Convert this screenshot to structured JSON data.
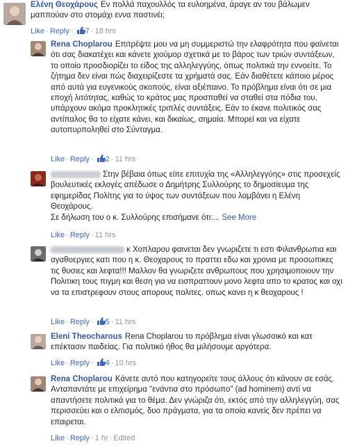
{
  "comments": [
    {
      "author": "Ελένη Θεοχάρους",
      "text": "Εν πολλά παχουλλός τα ευλοημένα, άραγε αν του βάλωμεν μαππούαν στο στομάχι εννα παστινέι;",
      "like": "Like",
      "reply": "Reply",
      "likes": "7",
      "time": "18 hrs"
    },
    {
      "author": "Rena Choplarou",
      "text": "Επιτρέψτε μου να μη συμμεριστώ την ελαφρότητα που φαίνεται ότι σας διακατέχει και κάνετε χιούμορ σχετικά με το βάρος των τριών συντάξεων, το οποίο προσδιορίζει το είδος της αλληλεγγύης, όπως πολιτικά την εννοείτε. Το ζήτημα δεν είναι πώς διαχειρίζεστε τα χρήματά σας. Εάν διαθέτετε κάποιο μέρος από αυτά για ευγενικούς σκοπούς, είναι αξιέπαινο. Το πρόβλημα είναι ότι σε μια εποχή λιτότητας, καθώς το κράτος μας προσπαθεί να σταθεί στα πόδια του, υπάρχουν ακόμα προκλητικές τριπλές συντάξεις. Εάν το έκανε πολιτικός σας αντίπαλος θα το είχατε κάνει, και δικαίως, σημαία. Μπορεί και να είχατε αυτοπυρποληθεί στο Σύνταγμα.",
      "like": "Like",
      "reply": "Reply",
      "likes": "2",
      "time": "11 hrs"
    },
    {
      "author": "",
      "text": "Στην βέβαια όπως είπε επιτυχία της «Αλληλεγγύης» στις προσεχείς βουλευτικές εκλογές απέδωσε ο Δημήτρης Συλλούρης το δημοσίευμα της εφημερίδας Πολίτης για το ύψος των συντάξεων που λαμβάνει η Ελένη Θεοχάρους.",
      "text2": "Σε δήλωση του ο κ. Συλλούρης επισήμανε ότι:...",
      "see_more": "See More",
      "like": "Like",
      "reply": "Reply",
      "time": "11 hrs"
    },
    {
      "author": "",
      "text": "κ Χοπλαρου φαινεται δεν γνωριζετε τι εστι Φιλανθρωπια και αγαθοεργιες κατι που η κ. Θεοχαρους το πραττει εδω και χρονια με προσωπικες τις θυσιες και λεφτα!!! Μαλλον θα γνωριζετε ανθρωπους που χρησιμοποιουν την Πολιτικη τους πιγμη και θεση για να εισπραττουν μονο λεφτα απο το κρατος και οχι να τα επιστρεφουν στους απορους πολιτες. οπως κανει η κ θεοχαρους !",
      "like": "Like",
      "reply": "Reply",
      "likes": "5",
      "time": "11 hrs"
    },
    {
      "author": "Eleni Theocharous",
      "text": "Rena Choplarou το πρόβλημα είναι γλωσσικό και κατ επέκτασιν παιδείας. Για πολιτικό ήθος θα μιλήσουμε αργότερα.",
      "like": "Like",
      "reply": "Reply",
      "likes": "4",
      "time": "10 hrs"
    },
    {
      "author": "Rena Choplarou",
      "text": "Κάνετε αυτό που κατηγορείτε τους άλλους ότι κάνουν σε εσάς. Ανταπαντάτε με επιχείρημα \"ενάντια στο πρόσωπο\" (ad hominem) αντί να απαντήσετε πολιτικά για το θέμα. Δεν γνώριζα ότι, εκτός από την αλληλεγγύη, σας περισσεύει και ο ελιτισμός, δυο πράγματα, για τα οποία κανείς δεν πρέπει να επαιρεται.",
      "like": "Like",
      "reply": "Reply",
      "time": "1 hr",
      "edited": "Edited"
    }
  ],
  "colors": {
    "link": "#365899",
    "action": "#4267b2",
    "meta": "#90949c"
  }
}
